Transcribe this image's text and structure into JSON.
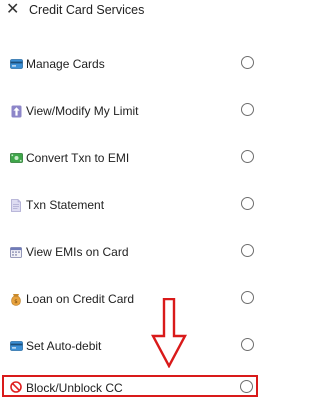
{
  "header": {
    "close_icon": "close-icon",
    "title": "Credit Card Services"
  },
  "menu": {
    "items": [
      {
        "label": "Manage Cards",
        "icon": "credit-card-icon",
        "selected": false
      },
      {
        "label": "View/Modify My Limit",
        "icon": "up-arrow-icon",
        "selected": false
      },
      {
        "label": "Convert Txn to EMI",
        "icon": "cash-icon",
        "selected": false
      },
      {
        "label": "Txn Statement",
        "icon": "document-icon",
        "selected": false
      },
      {
        "label": "View EMIs on Card",
        "icon": "calendar-icon",
        "selected": false
      },
      {
        "label": "Loan on Credit Card",
        "icon": "money-bag-icon",
        "selected": false
      },
      {
        "label": "Set Auto-debit",
        "icon": "credit-card-icon",
        "selected": false
      },
      {
        "label": "Block/Unblock CC",
        "icon": "prohibited-icon",
        "selected": false
      }
    ]
  },
  "annotation": {
    "color": "#d91a1a",
    "arrow_icon": "down-arrow-icon",
    "highlighted_item": "Block/Unblock CC"
  }
}
